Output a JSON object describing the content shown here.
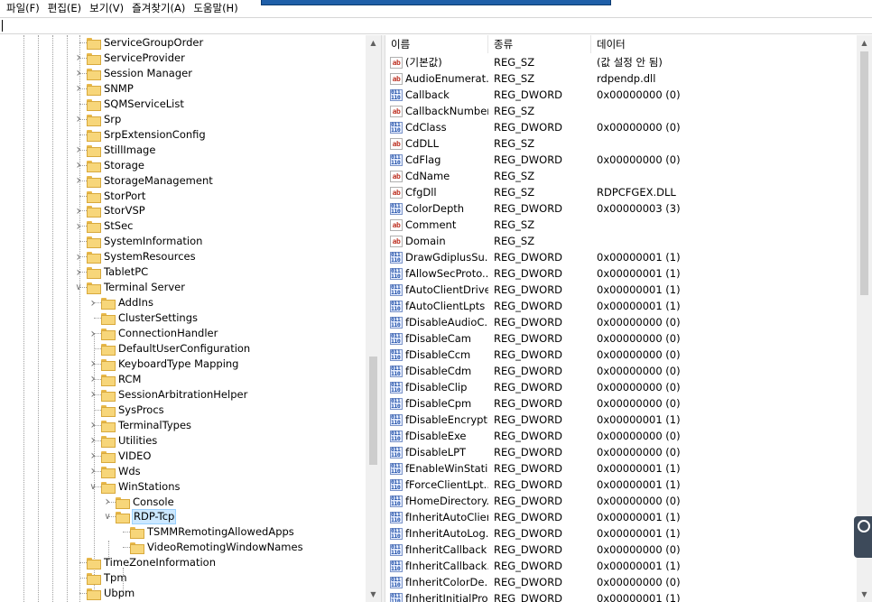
{
  "menu": [
    "파일(F)",
    "편집(E)",
    "보기(V)",
    "즐겨찾기(A)",
    "도움말(H)"
  ],
  "address": {
    "value": ""
  },
  "tree": [
    {
      "label": "ServiceGroupOrder",
      "exp": ""
    },
    {
      "label": "ServiceProvider",
      "exp": ">"
    },
    {
      "label": "Session Manager",
      "exp": ">"
    },
    {
      "label": "SNMP",
      "exp": ">"
    },
    {
      "label": "SQMServiceList",
      "exp": ""
    },
    {
      "label": "Srp",
      "exp": ">"
    },
    {
      "label": "SrpExtensionConfig",
      "exp": ""
    },
    {
      "label": "StillImage",
      "exp": ">"
    },
    {
      "label": "Storage",
      "exp": ">"
    },
    {
      "label": "StorageManagement",
      "exp": ">"
    },
    {
      "label": "StorPort",
      "exp": ""
    },
    {
      "label": "StorVSP",
      "exp": ">"
    },
    {
      "label": "StSec",
      "exp": ">"
    },
    {
      "label": "SystemInformation",
      "exp": ""
    },
    {
      "label": "SystemResources",
      "exp": ">"
    },
    {
      "label": "TabletPC",
      "exp": ">"
    },
    {
      "label": "Terminal Server",
      "exp": "v"
    },
    {
      "label": "AddIns",
      "exp": ">"
    },
    {
      "label": "ClusterSettings",
      "exp": ""
    },
    {
      "label": "ConnectionHandler",
      "exp": ">"
    },
    {
      "label": "DefaultUserConfiguration",
      "exp": ""
    },
    {
      "label": "KeyboardType Mapping",
      "exp": ">"
    },
    {
      "label": "RCM",
      "exp": ">"
    },
    {
      "label": "SessionArbitrationHelper",
      "exp": ">"
    },
    {
      "label": "SysProcs",
      "exp": ""
    },
    {
      "label": "TerminalTypes",
      "exp": ">"
    },
    {
      "label": "Utilities",
      "exp": ">"
    },
    {
      "label": "VIDEO",
      "exp": ">"
    },
    {
      "label": "Wds",
      "exp": ">"
    },
    {
      "label": "WinStations",
      "exp": "v"
    },
    {
      "label": "Console",
      "exp": ">"
    },
    {
      "label": "RDP-Tcp",
      "exp": "v",
      "selected": true
    },
    {
      "label": "TSMMRemotingAllowedApps",
      "exp": ""
    },
    {
      "label": "VideoRemotingWindowNames",
      "exp": ""
    },
    {
      "label": "TimeZoneInformation",
      "exp": ""
    },
    {
      "label": "Tpm",
      "exp": ""
    },
    {
      "label": "Ubpm",
      "exp": ""
    }
  ],
  "list": {
    "headers": [
      "이름",
      "종류",
      "데이터"
    ],
    "rows": [
      {
        "type": "sz",
        "name": "(기본값)",
        "kind": "REG_SZ",
        "data": "(값 설정 안 됨)"
      },
      {
        "type": "sz",
        "name": "AudioEnumerat...",
        "kind": "REG_SZ",
        "data": "rdpendp.dll"
      },
      {
        "type": "dw",
        "name": "Callback",
        "kind": "REG_DWORD",
        "data": "0x00000000 (0)"
      },
      {
        "type": "sz",
        "name": "CallbackNumber",
        "kind": "REG_SZ",
        "data": ""
      },
      {
        "type": "dw",
        "name": "CdClass",
        "kind": "REG_DWORD",
        "data": "0x00000000 (0)"
      },
      {
        "type": "sz",
        "name": "CdDLL",
        "kind": "REG_SZ",
        "data": ""
      },
      {
        "type": "dw",
        "name": "CdFlag",
        "kind": "REG_DWORD",
        "data": "0x00000000 (0)"
      },
      {
        "type": "sz",
        "name": "CdName",
        "kind": "REG_SZ",
        "data": ""
      },
      {
        "type": "sz",
        "name": "CfgDll",
        "kind": "REG_SZ",
        "data": "RDPCFGEX.DLL"
      },
      {
        "type": "dw",
        "name": "ColorDepth",
        "kind": "REG_DWORD",
        "data": "0x00000003 (3)"
      },
      {
        "type": "sz",
        "name": "Comment",
        "kind": "REG_SZ",
        "data": ""
      },
      {
        "type": "sz",
        "name": "Domain",
        "kind": "REG_SZ",
        "data": ""
      },
      {
        "type": "dw",
        "name": "DrawGdiplusSu...",
        "kind": "REG_DWORD",
        "data": "0x00000001 (1)"
      },
      {
        "type": "dw",
        "name": "fAllowSecProto...",
        "kind": "REG_DWORD",
        "data": "0x00000001 (1)"
      },
      {
        "type": "dw",
        "name": "fAutoClientDrives",
        "kind": "REG_DWORD",
        "data": "0x00000001 (1)"
      },
      {
        "type": "dw",
        "name": "fAutoClientLpts",
        "kind": "REG_DWORD",
        "data": "0x00000001 (1)"
      },
      {
        "type": "dw",
        "name": "fDisableAudioC...",
        "kind": "REG_DWORD",
        "data": "0x00000000 (0)"
      },
      {
        "type": "dw",
        "name": "fDisableCam",
        "kind": "REG_DWORD",
        "data": "0x00000000 (0)"
      },
      {
        "type": "dw",
        "name": "fDisableCcm",
        "kind": "REG_DWORD",
        "data": "0x00000000 (0)"
      },
      {
        "type": "dw",
        "name": "fDisableCdm",
        "kind": "REG_DWORD",
        "data": "0x00000000 (0)"
      },
      {
        "type": "dw",
        "name": "fDisableClip",
        "kind": "REG_DWORD",
        "data": "0x00000000 (0)"
      },
      {
        "type": "dw",
        "name": "fDisableCpm",
        "kind": "REG_DWORD",
        "data": "0x00000000 (0)"
      },
      {
        "type": "dw",
        "name": "fDisableEncrypti...",
        "kind": "REG_DWORD",
        "data": "0x00000001 (1)"
      },
      {
        "type": "dw",
        "name": "fDisableExe",
        "kind": "REG_DWORD",
        "data": "0x00000000 (0)"
      },
      {
        "type": "dw",
        "name": "fDisableLPT",
        "kind": "REG_DWORD",
        "data": "0x00000000 (0)"
      },
      {
        "type": "dw",
        "name": "fEnableWinStati...",
        "kind": "REG_DWORD",
        "data": "0x00000001 (1)"
      },
      {
        "type": "dw",
        "name": "fForceClientLpt...",
        "kind": "REG_DWORD",
        "data": "0x00000001 (1)"
      },
      {
        "type": "dw",
        "name": "fHomeDirectory...",
        "kind": "REG_DWORD",
        "data": "0x00000000 (0)"
      },
      {
        "type": "dw",
        "name": "fInheritAutoClient",
        "kind": "REG_DWORD",
        "data": "0x00000001 (1)"
      },
      {
        "type": "dw",
        "name": "fInheritAutoLog...",
        "kind": "REG_DWORD",
        "data": "0x00000001 (1)"
      },
      {
        "type": "dw",
        "name": "fInheritCallback",
        "kind": "REG_DWORD",
        "data": "0x00000000 (0)"
      },
      {
        "type": "dw",
        "name": "fInheritCallback...",
        "kind": "REG_DWORD",
        "data": "0x00000001 (1)"
      },
      {
        "type": "dw",
        "name": "fInheritColorDe...",
        "kind": "REG_DWORD",
        "data": "0x00000000 (0)"
      },
      {
        "type": "dw",
        "name": "fInheritInitialPro...",
        "kind": "REG_DWORD",
        "data": "0x00000001 (1)"
      }
    ]
  },
  "icons": {
    "string_value": "ab",
    "dword_value": "011 110"
  }
}
